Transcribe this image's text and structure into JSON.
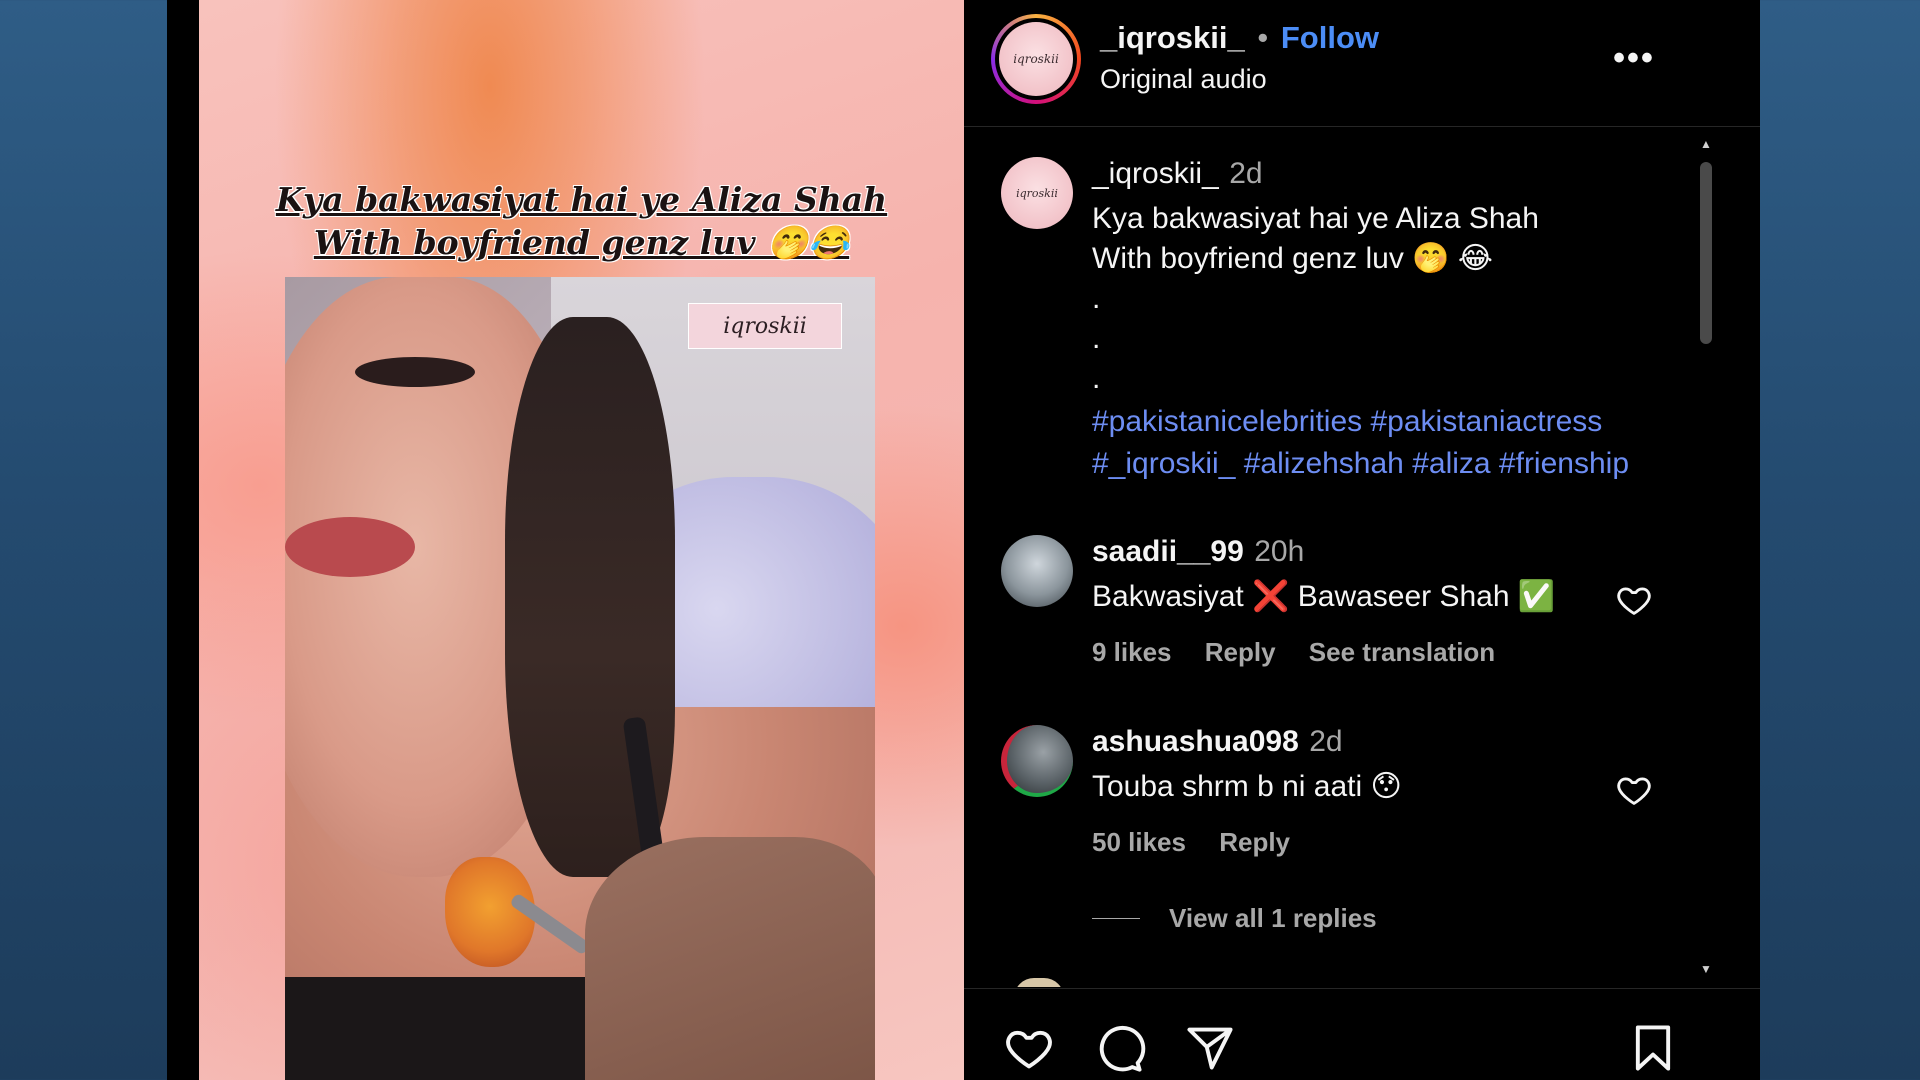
{
  "post": {
    "overlay_caption": [
      "Kya bakwasiyat hai ye Aliza Shah",
      "With boyfriend genz luv 🤭😂"
    ],
    "watermark": "iqroskii"
  },
  "header": {
    "username": "_iqroskii_",
    "separator": "•",
    "follow_label": "Follow",
    "audio_label": "Original audio",
    "more_label": "•••",
    "avatar_text": "iqroskii"
  },
  "caption": {
    "username": "_iqroskii_",
    "time": "2d",
    "lines": [
      "Kya bakwasiyat hai ye Aliza Shah",
      "With boyfriend genz luv 🤭 😂",
      ".",
      ".",
      "."
    ],
    "hashtags_line1": "#pakistanicelebrities #pakistaniactress",
    "hashtags_line2": "#_iqroskii_ #alizehshah #aliza #frienship"
  },
  "comments": [
    {
      "username": "saadii__99",
      "time": "20h",
      "text": "Bakwasiyat ❌ Bawaseer Shah ✅",
      "likes": "9 likes",
      "reply_label": "Reply",
      "translation_label": "See translation"
    },
    {
      "username": "ashuashua098",
      "time": "2d",
      "text": "Touba shrm b ni aati 😯",
      "likes": "50 likes",
      "reply_label": "Reply",
      "view_replies_label": "View all 1 replies"
    }
  ],
  "icons": {
    "like": "heart-icon",
    "comment": "comment-bubble-icon",
    "share": "paper-plane-icon",
    "save": "bookmark-icon",
    "comment_like": "heart-outline-icon"
  },
  "colors": {
    "background_left": "#2f5d86",
    "panel": "#000000",
    "link": "#4c8df6",
    "hashtag": "#6d8df2",
    "muted": "#a8a8a8"
  }
}
